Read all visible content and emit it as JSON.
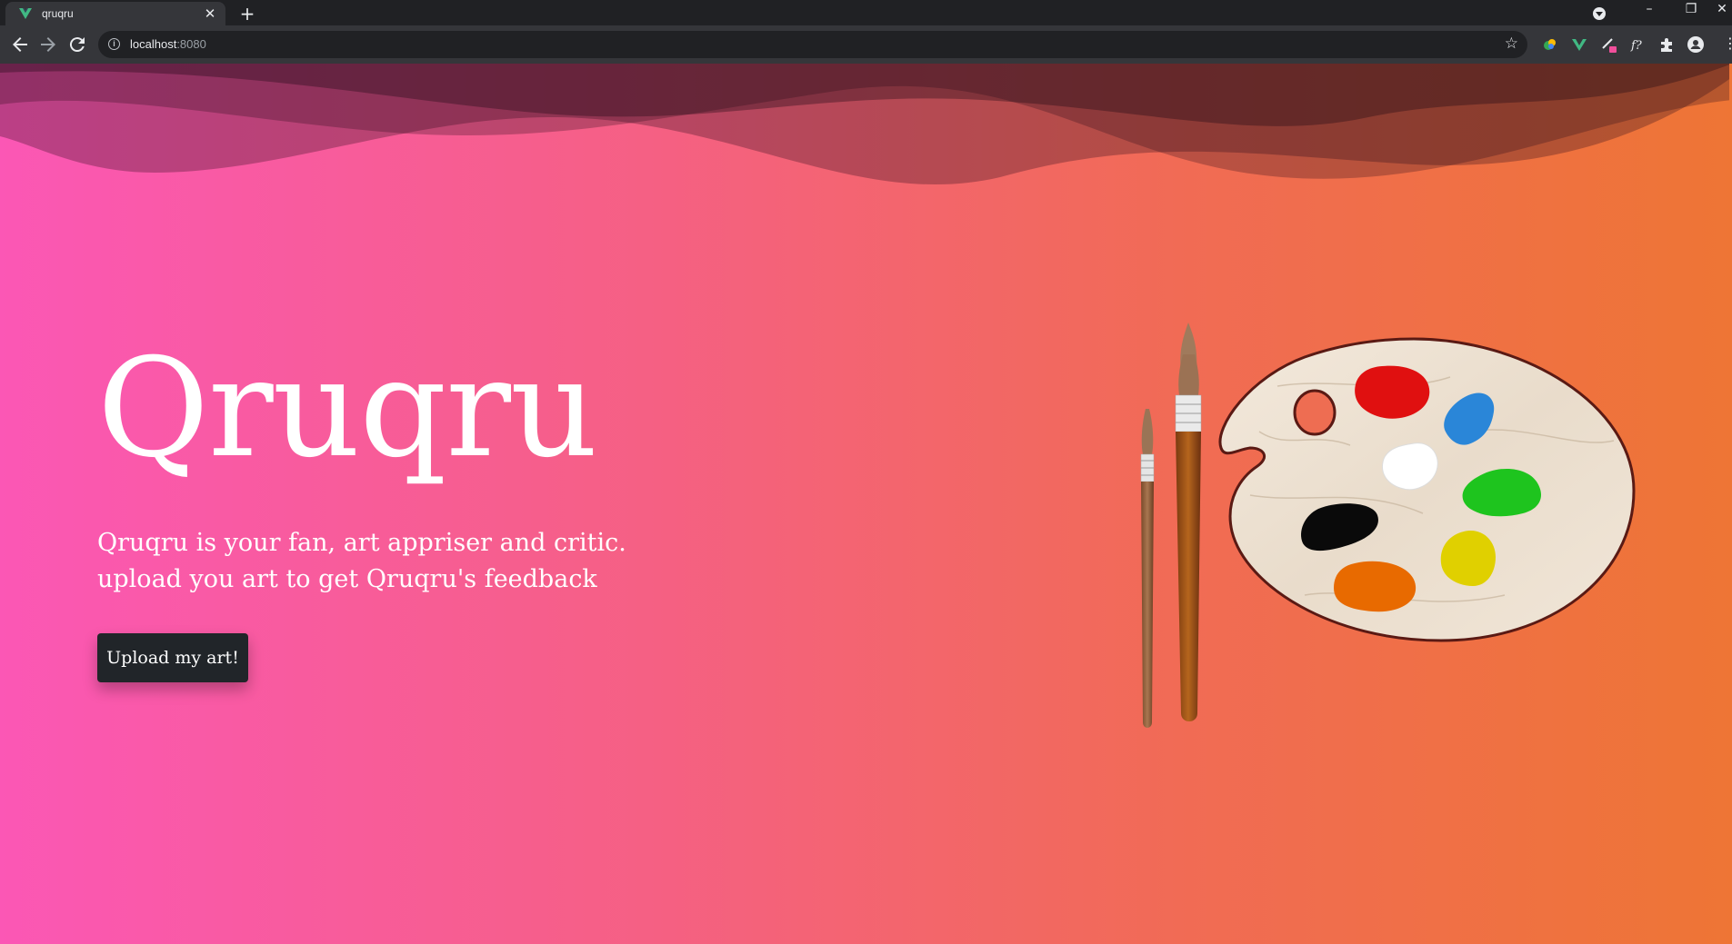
{
  "browser": {
    "tab_title": "qruqru",
    "tab_close": "✕",
    "new_tab": "+",
    "url_host": "localhost",
    "url_port": ":8080",
    "window_controls": {
      "minimize": "–",
      "restore": "❐",
      "close": "✕"
    }
  },
  "hero": {
    "title": "Qruqru",
    "subtitle_line1": "Qruqru is your fan, art appriser and critic.",
    "subtitle_line2": "upload you art to get Qruqru's feedback",
    "cta_label": "Upload my art!"
  },
  "colors": {
    "gradient_left": "#fb57b5",
    "gradient_right": "#ee7535",
    "button_bg": "#212529",
    "text": "#ffffff"
  },
  "icons": [
    "vue-favicon-icon",
    "back-arrow-icon",
    "forward-arrow-icon",
    "reload-icon",
    "info-icon",
    "star-icon",
    "puzzle-extension-icon",
    "profile-icon",
    "menu-dots-icon",
    "palette-illustration",
    "paintbrush-illustration"
  ]
}
